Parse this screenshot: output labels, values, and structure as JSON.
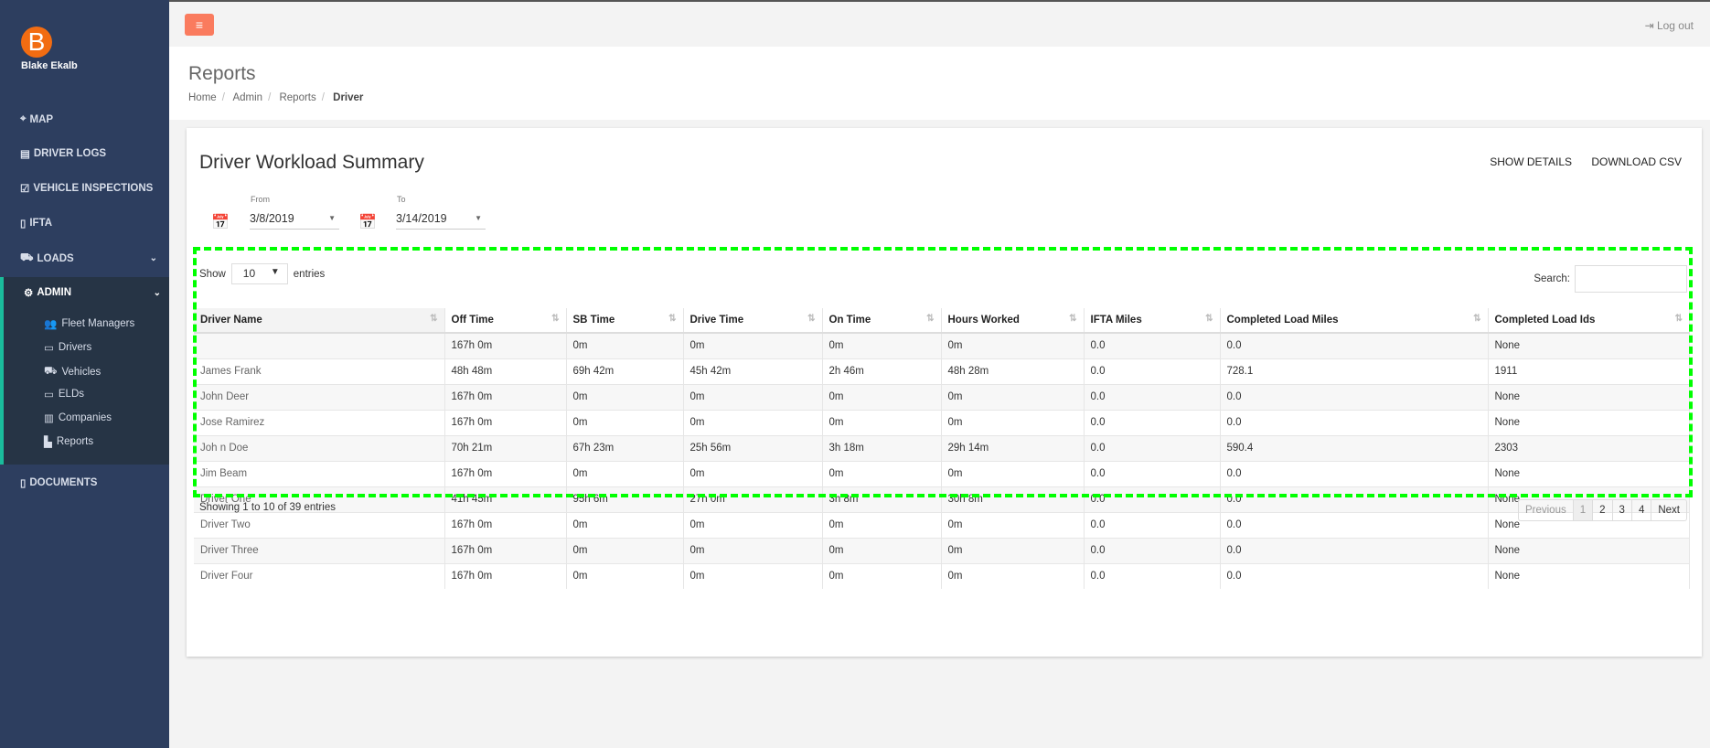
{
  "user": {
    "initial": "B",
    "name": "Blake Ekalb"
  },
  "sidebar": {
    "items": [
      {
        "label": "MAP",
        "icon": "map-pin-icon"
      },
      {
        "label": "DRIVER LOGS",
        "icon": "logbook-icon"
      },
      {
        "label": "VEHICLE INSPECTIONS",
        "icon": "clipboard-icon"
      },
      {
        "label": "IFTA",
        "icon": "file-icon"
      },
      {
        "label": "LOADS",
        "icon": "truck-icon"
      },
      {
        "label": "ADMIN",
        "icon": "gear-icon"
      },
      {
        "label": "DOCUMENTS",
        "icon": "file-icon"
      }
    ],
    "admin_sub": [
      {
        "label": "Fleet Managers",
        "icon": "users-icon"
      },
      {
        "label": "Drivers",
        "icon": "id-card-icon"
      },
      {
        "label": "Vehicles",
        "icon": "truck-icon"
      },
      {
        "label": "ELDs",
        "icon": "laptop-icon"
      },
      {
        "label": "Companies",
        "icon": "building-icon"
      },
      {
        "label": "Reports",
        "icon": "bar-chart-icon"
      }
    ]
  },
  "topbar": {
    "logout": "Log out",
    "accent": "#fa7b5e"
  },
  "header": {
    "title": "Reports",
    "breadcrumb": [
      "Home",
      "Admin",
      "Reports",
      "Driver"
    ]
  },
  "panel": {
    "title": "Driver Workload Summary",
    "show_details": "SHOW DETAILS",
    "download_csv": "DOWNLOAD CSV",
    "from_label": "From",
    "from": "3/8/2019",
    "to_label": "To",
    "to": "3/14/2019",
    "show": "Show",
    "entries_value": "10",
    "entries": "entries",
    "search_label": "Search:",
    "search_value": "",
    "info": "Showing 1 to 10 of 39 entries",
    "pager": [
      "Previous",
      "1",
      "2",
      "3",
      "4",
      "Next"
    ]
  },
  "table": {
    "headers": [
      "Driver Name",
      "Off Time",
      "SB Time",
      "Drive Time",
      "On Time",
      "Hours Worked",
      "IFTA Miles",
      "Completed Load Miles",
      "Completed Load Ids"
    ],
    "rows": [
      [
        "",
        "167h 0m",
        "0m",
        "0m",
        "0m",
        "0m",
        "0.0",
        "0.0",
        "None"
      ],
      [
        "James Frank",
        "48h 48m",
        "69h 42m",
        "45h 42m",
        "2h 46m",
        "48h 28m",
        "0.0",
        "728.1",
        "1911"
      ],
      [
        "John Deer",
        "167h 0m",
        "0m",
        "0m",
        "0m",
        "0m",
        "0.0",
        "0.0",
        "None"
      ],
      [
        "Jose Ramirez",
        "167h 0m",
        "0m",
        "0m",
        "0m",
        "0m",
        "0.0",
        "0.0",
        "None"
      ],
      [
        "Joh n Doe",
        "70h 21m",
        "67h 23m",
        "25h 56m",
        "3h 18m",
        "29h 14m",
        "0.0",
        "590.4",
        "2303"
      ],
      [
        "Jim Beam",
        "167h 0m",
        "0m",
        "0m",
        "0m",
        "0m",
        "0.0",
        "0.0",
        "None"
      ],
      [
        "Driver One",
        "41h 45m",
        "95h 6m",
        "27h 0m",
        "3h 8m",
        "30h 8m",
        "0.0",
        "0.0",
        "None"
      ],
      [
        "Driver Two",
        "167h 0m",
        "0m",
        "0m",
        "0m",
        "0m",
        "0.0",
        "0.0",
        "None"
      ],
      [
        "Driver Three",
        "167h 0m",
        "0m",
        "0m",
        "0m",
        "0m",
        "0.0",
        "0.0",
        "None"
      ],
      [
        "Driver Four",
        "167h 0m",
        "0m",
        "0m",
        "0m",
        "0m",
        "0.0",
        "0.0",
        "None"
      ]
    ]
  }
}
